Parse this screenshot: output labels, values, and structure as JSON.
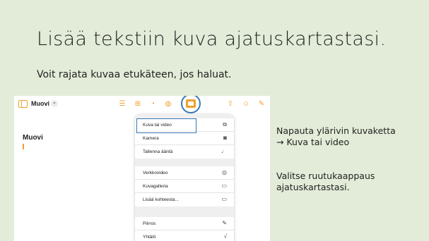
{
  "slide": {
    "title": "Lisää tekstiin kuva ajatuskartastasi.",
    "subtitle": "Voit rajata kuvaa etukäteen, jos haluat.",
    "instruction_line1": "Napauta ylärivin kuvaketta",
    "instruction_line2": "→ Kuva tai video",
    "instruction2_line1": "Valitse ruutukaappaus",
    "instruction2_line2": "ajatuskartastasi."
  },
  "app": {
    "doc_name": "Muovi",
    "note_title": "Muovi",
    "accent_color": "#f0a030",
    "highlight_color": "#3a78b8",
    "toolbar_icons": [
      "list-icon",
      "table-icon",
      "chart-icon",
      "shapes-icon",
      "media-icon",
      "share-icon",
      "comment-icon",
      "format-icon"
    ]
  },
  "menu": {
    "groups": [
      [
        {
          "label": "Kuva tai video",
          "icon": "photo-icon",
          "glyph": "⧉"
        },
        {
          "label": "Kamera",
          "icon": "camera-icon",
          "glyph": "◙"
        },
        {
          "label": "Tallenna ääntä",
          "icon": "mic-icon",
          "glyph": "♩"
        }
      ],
      [
        {
          "label": "Verkkovideo",
          "icon": "web-video-icon",
          "glyph": "◎"
        },
        {
          "label": "Kuvagalleria",
          "icon": "gallery-icon",
          "glyph": "▭"
        },
        {
          "label": "Lisää kohteesta...",
          "icon": "folder-icon",
          "glyph": "▭"
        }
      ],
      [
        {
          "label": "Piirros",
          "icon": "drawing-icon",
          "glyph": "✎"
        },
        {
          "label": "Yhtälö",
          "icon": "equation-icon",
          "glyph": "√"
        }
      ]
    ]
  }
}
